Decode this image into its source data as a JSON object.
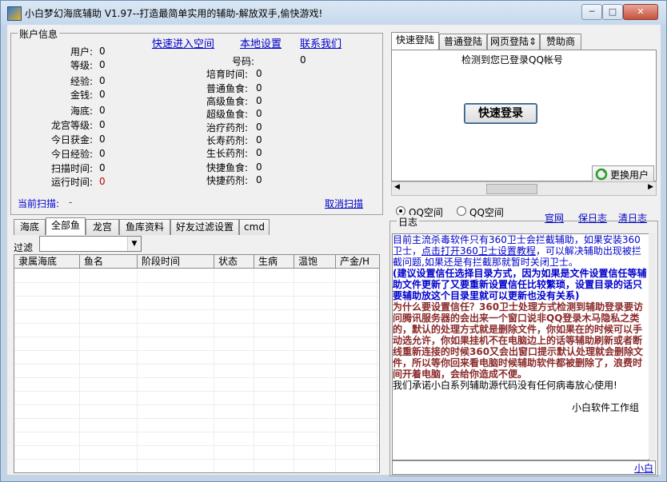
{
  "window": {
    "title": "小白梦幻海底辅助 V1.97--打造最简单实用的辅助-解放双手,偷快游戏!",
    "min": "─",
    "max": "□",
    "close": "✕"
  },
  "account": {
    "legend": "账户信息",
    "links": {
      "quick_space": "快速进入空间",
      "local_settings": "本地设置",
      "contact": "联系我们"
    },
    "left": [
      {
        "label": "用户:",
        "value": "0"
      },
      {
        "label": "等级:",
        "value": "0"
      },
      {
        "label": "经验:",
        "value": "0"
      },
      {
        "label": "金钱:",
        "value": "0"
      },
      {
        "label": "海底:",
        "value": "0"
      },
      {
        "label": "龙宫等级:",
        "value": "0"
      },
      {
        "label": "今日获金:",
        "value": "0"
      },
      {
        "label": "今日经验:",
        "value": "0"
      },
      {
        "label": "扫描时间:",
        "value": "0"
      },
      {
        "label": "运行时间:",
        "value": "0"
      }
    ],
    "qq": {
      "label": "号码:",
      "value": "0"
    },
    "right": [
      {
        "label": "培育时间:",
        "value": "0"
      },
      {
        "label": "普通鱼食:",
        "value": "0"
      },
      {
        "label": "高级鱼食:",
        "value": "0"
      },
      {
        "label": "超级鱼食:",
        "value": "0"
      },
      {
        "label": "治疗药剂:",
        "value": "0"
      },
      {
        "label": "长寿药剂:",
        "value": "0"
      },
      {
        "label": "生长药剂:",
        "value": "0"
      },
      {
        "label": "快捷鱼食:",
        "value": "0"
      },
      {
        "label": "快捷药剂:",
        "value": "0"
      }
    ],
    "scan_label": "当前扫描:",
    "scan_value": "-",
    "cancel_scan": "取消扫描"
  },
  "login_tabs": [
    "快速登陆",
    "普通登陆",
    "网页登陆",
    "赞助商"
  ],
  "login_tab_web_suffix": "⇕",
  "login": {
    "detected": "检测到您已登录QQ帐号",
    "button": "快速登录",
    "switch_user": "更换用户"
  },
  "bottom_tabs": [
    "海底",
    "全部鱼",
    "龙宫",
    "鱼库资料",
    "好友过滤设置",
    "cmd"
  ],
  "filter": {
    "label": "过滤",
    "value": ""
  },
  "grid_columns": [
    "隶属海底",
    "鱼名",
    "阶段时间",
    "状态",
    "生病",
    "温饱",
    "产金/H"
  ],
  "radios": [
    {
      "label": "QQ空间",
      "checked": true
    },
    {
      "label": "QQ空间",
      "checked": false
    }
  ],
  "log_links": {
    "website": "官网",
    "save_log": "保日志",
    "clear_log": "清日志"
  },
  "log": {
    "legend": "日志",
    "line1a": "目前主流杀毒软件只有360卫士会拦截辅助，如果安装360卫士，",
    "line1_link": "点击打开360卫士设置教程",
    "line1b": "，可以解决辅助出现被拦截问题,如果还是有拦截那就暂时关闭卫士。",
    "line2": "(建议设置信任选择目录方式，因为如果是文件设置信任等辅助文件更新了又要重新设置信任比较繁琐，设置目录的话只要辅助放这个目录里就可以更新也没有关系)",
    "line3": "为什么要设置信任？360卫士处理方式检测到辅助登录要访问腾讯服务器的会出来一个窗口说非QQ登录木马隐私之类的，默认的处理方式就是删除文件，你如果在的时候可以手动选允许，你如果挂机不在电脑边上的话等辅助刷新或者断线重新连接的时候360又会出窗口提示默认处理就会删除文件，所以等你回来看电脑时候辅助软件都被删除了，浪费时间开着电脑，会给你造成不便。",
    "line4": "我们承诺小白系列辅助源代码没有任何病毒放心使用!",
    "signature": "小白软件工作组",
    "footer": "小白"
  }
}
